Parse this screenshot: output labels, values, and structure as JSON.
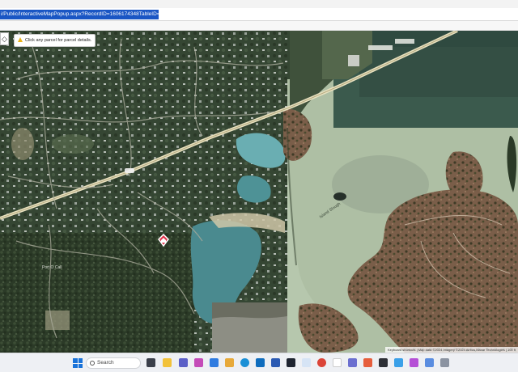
{
  "browser": {
    "url_selected": "i/Public/InteractiveMapPopup.aspx?RecordID=1606174348TableID=9&L=1"
  },
  "map": {
    "zoom_symbol": "◇",
    "hint_icon": "warning-icon",
    "hint_text": "Click any parcel for parcel details.",
    "attribution": "Keyboard shortcuts | Map data ©2024 Imagery ©2024 Airbus,Maxar Technologies | 100 ft",
    "road_label": "",
    "place_label_1": "Port O Call",
    "water_label": "Island Slough"
  },
  "taskbar": {
    "search_placeholder": "Search",
    "pinned_icons": [
      "widgets-icon",
      "file-explorer-icon",
      "teams-icon",
      "copilot-icon",
      "store-icon",
      "folder-icon",
      "edge-icon",
      "outlook-icon",
      "word-icon",
      "l-app-icon",
      "app-icon",
      "chrome-icon",
      "mail-icon",
      "calendar-icon",
      "paint-icon",
      "app-icon-2",
      "app-icon-3",
      "photos-icon",
      "phone-icon",
      "settings-icon"
    ]
  },
  "colors": {
    "url_highlight": "#1a56c4",
    "warning": "#e8b21a",
    "marker": "#e0324a",
    "win_blue": "#1a73d9"
  }
}
